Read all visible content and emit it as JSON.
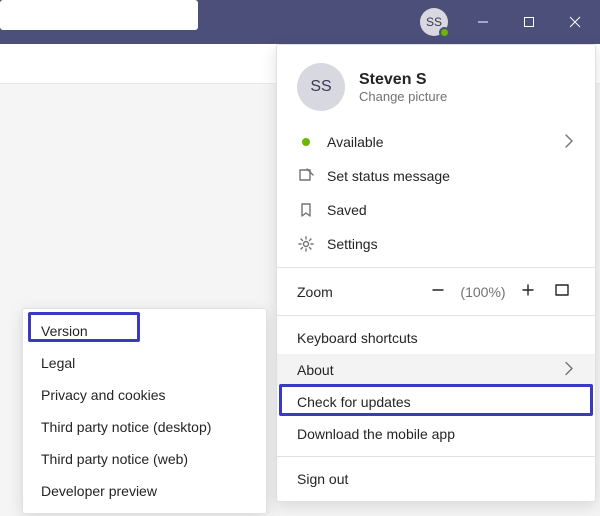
{
  "titlebar": {
    "avatar_initials": "SS"
  },
  "profile": {
    "avatar_initials": "SS",
    "name": "Steven S",
    "change_picture": "Change picture"
  },
  "status": {
    "label": "Available"
  },
  "menu": {
    "set_status": "Set status message",
    "saved": "Saved",
    "settings": "Settings"
  },
  "zoom": {
    "label": "Zoom",
    "value": "(100%)"
  },
  "items": {
    "keyboard_shortcuts": "Keyboard shortcuts",
    "about": "About",
    "check_for_updates": "Check for updates",
    "download_mobile": "Download the mobile app",
    "sign_out": "Sign out"
  },
  "about_submenu": {
    "version": "Version",
    "legal": "Legal",
    "privacy": "Privacy and cookies",
    "tpn_desktop": "Third party notice (desktop)",
    "tpn_web": "Third party notice (web)",
    "dev_preview": "Developer preview"
  }
}
